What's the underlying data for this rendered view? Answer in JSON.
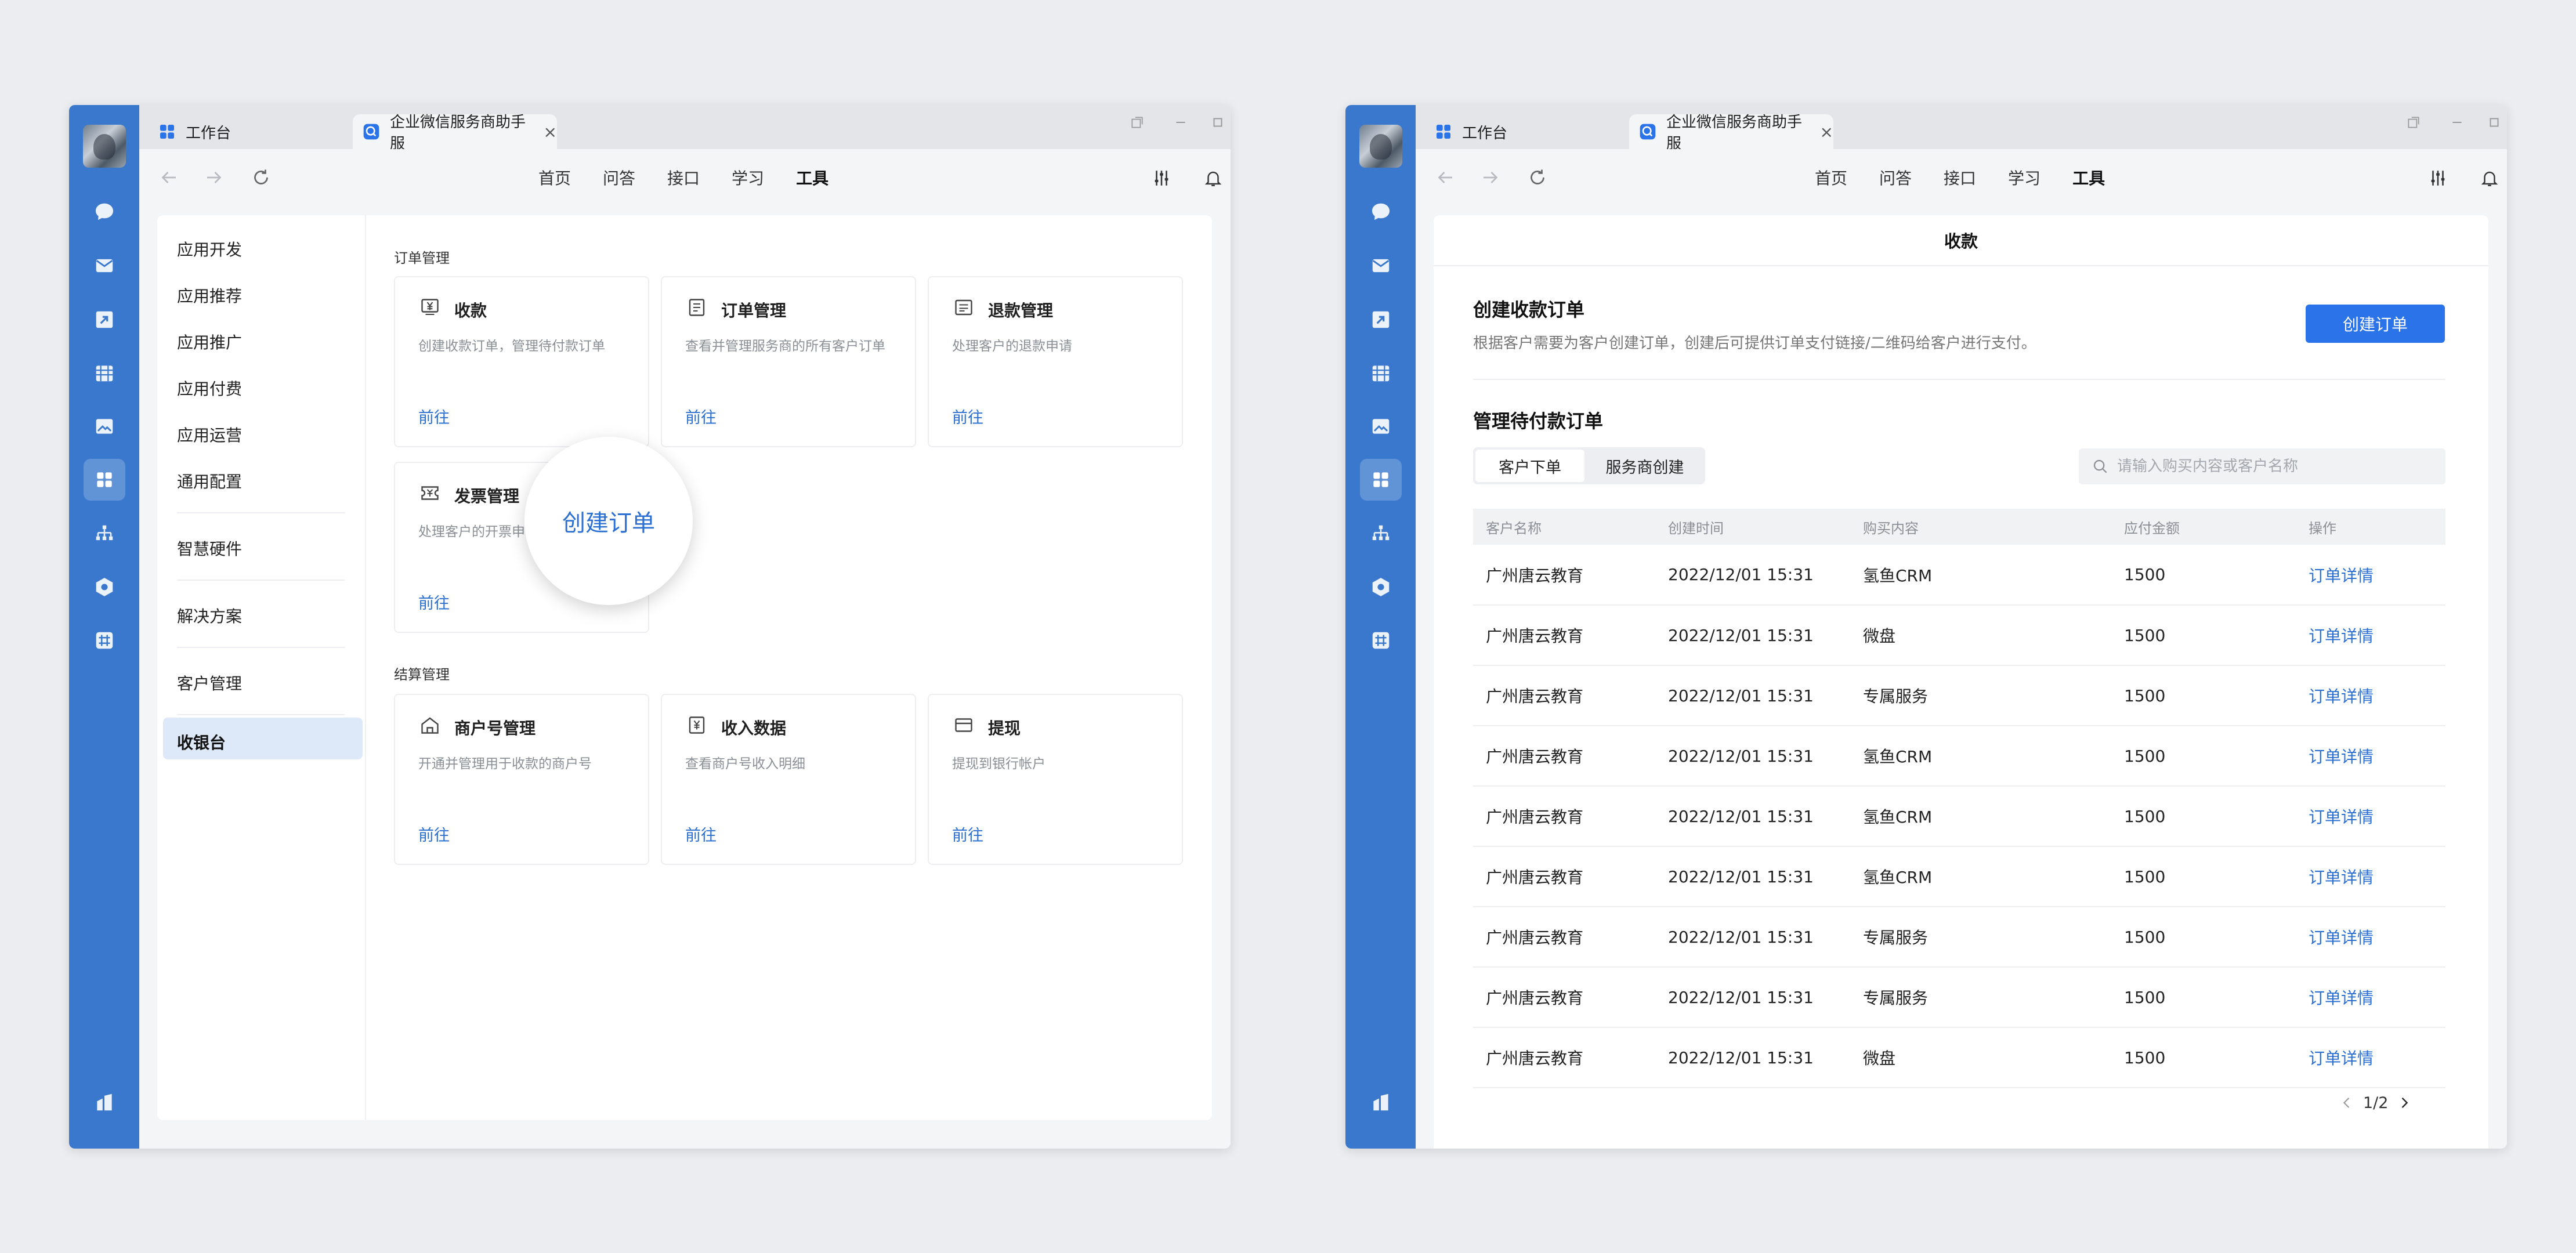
{
  "left_window": {
    "tabs": [
      {
        "label": "工作台"
      },
      {
        "label": "企业微信服务商助手服"
      }
    ],
    "topnav": [
      "首页",
      "问答",
      "接口",
      "学习",
      "工具"
    ],
    "sidenav": [
      "应用开发",
      "应用推荐",
      "应用推广",
      "应用付费",
      "应用运营",
      "通用配置",
      "智慧硬件",
      "解决方案",
      "客户管理",
      "收银台"
    ],
    "sections": [
      {
        "title": "订单管理"
      },
      {
        "title": "结算管理"
      }
    ],
    "cards": [
      {
        "title": "收款",
        "desc": "创建收款订单，管理待付款订单",
        "link": "前往"
      },
      {
        "title": "订单管理",
        "desc": "查看并管理服务商的所有客户订单",
        "link": "前往"
      },
      {
        "title": "退款管理",
        "desc": "处理客户的退款申请",
        "link": "前往"
      },
      {
        "title": "发票管理",
        "desc": "处理客户的开票申请",
        "link": "前往"
      },
      {
        "title": "商户号管理",
        "desc": "开通并管理用于收款的商户号",
        "link": "前往"
      },
      {
        "title": "收入数据",
        "desc": "查看商户号收入明细",
        "link": "前往"
      },
      {
        "title": "提现",
        "desc": "提现到银行帐户",
        "link": "前往"
      }
    ],
    "magnifier_label": "创建订单"
  },
  "right_window": {
    "tabs": [
      {
        "label": "工作台"
      },
      {
        "label": "企业微信服务商助手服"
      }
    ],
    "topnav": [
      "首页",
      "问答",
      "接口",
      "学习",
      "工具"
    ],
    "page_title": "收款",
    "create": {
      "title": "创建收款订单",
      "desc": "根据客户需要为客户创建订单，创建后可提供订单支付链接/二维码给客户进行支付。",
      "button": "创建订单"
    },
    "manage": {
      "title": "管理待付款订单",
      "seg": [
        "客户下单",
        "服务商创建"
      ],
      "search_placeholder": "请输入购买内容或客户名称"
    },
    "table": {
      "headers": [
        "客户名称",
        "创建时间",
        "购买内容",
        "应付金额",
        "操作"
      ],
      "rows": [
        [
          "广州唐云教育",
          "2022/12/01 15:31",
          "氢鱼CRM",
          "1500",
          "订单详情"
        ],
        [
          "广州唐云教育",
          "2022/12/01 15:31",
          "微盘",
          "1500",
          "订单详情"
        ],
        [
          "广州唐云教育",
          "2022/12/01 15:31",
          "专属服务",
          "1500",
          "订单详情"
        ],
        [
          "广州唐云教育",
          "2022/12/01 15:31",
          "氢鱼CRM",
          "1500",
          "订单详情"
        ],
        [
          "广州唐云教育",
          "2022/12/01 15:31",
          "氢鱼CRM",
          "1500",
          "订单详情"
        ],
        [
          "广州唐云教育",
          "2022/12/01 15:31",
          "氢鱼CRM",
          "1500",
          "订单详情"
        ],
        [
          "广州唐云教育",
          "2022/12/01 15:31",
          "专属服务",
          "1500",
          "订单详情"
        ],
        [
          "广州唐云教育",
          "2022/12/01 15:31",
          "专属服务",
          "1500",
          "订单详情"
        ],
        [
          "广州唐云教育",
          "2022/12/01 15:31",
          "微盘",
          "1500",
          "订单详情"
        ]
      ]
    },
    "pager": "1/2"
  },
  "rail_icons": [
    "chat-icon",
    "mail-icon",
    "share-icon",
    "calendar-icon",
    "image-icon",
    "workbench-icon",
    "org-chart-icon",
    "box-icon",
    "grid-icon",
    "company-icon"
  ],
  "colors": {
    "rail": "#3a78ce",
    "accent": "#2a73e8",
    "link": "#2a6fd1"
  }
}
